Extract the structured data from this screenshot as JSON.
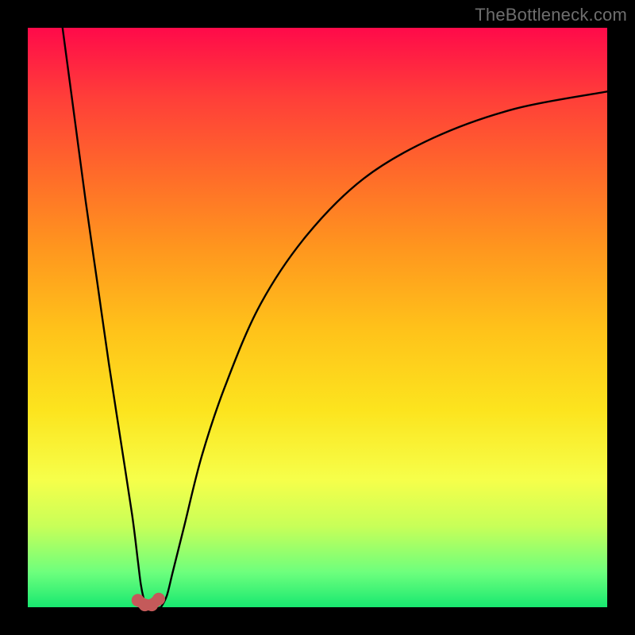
{
  "watermark": "TheBottleneck.com",
  "chart_data": {
    "type": "line",
    "title": "",
    "xlabel": "",
    "ylabel": "",
    "xlim": [
      0,
      100
    ],
    "ylim": [
      0,
      100
    ],
    "background_gradient_meaning": "top = bad (red), bottom = good (green)",
    "series": [
      {
        "name": "left-curve",
        "x": [
          6,
          8,
          10,
          12,
          14,
          16,
          18,
          19,
          19.5,
          20,
          20.5
        ],
        "y": [
          100,
          85,
          70,
          56,
          42,
          29,
          16,
          8,
          4,
          1.5,
          0
        ]
      },
      {
        "name": "right-curve",
        "x": [
          23,
          24,
          25,
          27,
          30,
          34,
          40,
          48,
          58,
          70,
          84,
          100
        ],
        "y": [
          0,
          2,
          6,
          14,
          26,
          38,
          52,
          64,
          74,
          81,
          86,
          89
        ]
      }
    ],
    "highlight_markers": [
      {
        "x": 19.0,
        "y": 1.2
      },
      {
        "x": 20.2,
        "y": 0.4
      },
      {
        "x": 21.4,
        "y": 0.4
      },
      {
        "x": 22.6,
        "y": 1.4
      }
    ],
    "highlight_color": "#c45a5a",
    "curve_color": "#000000"
  }
}
